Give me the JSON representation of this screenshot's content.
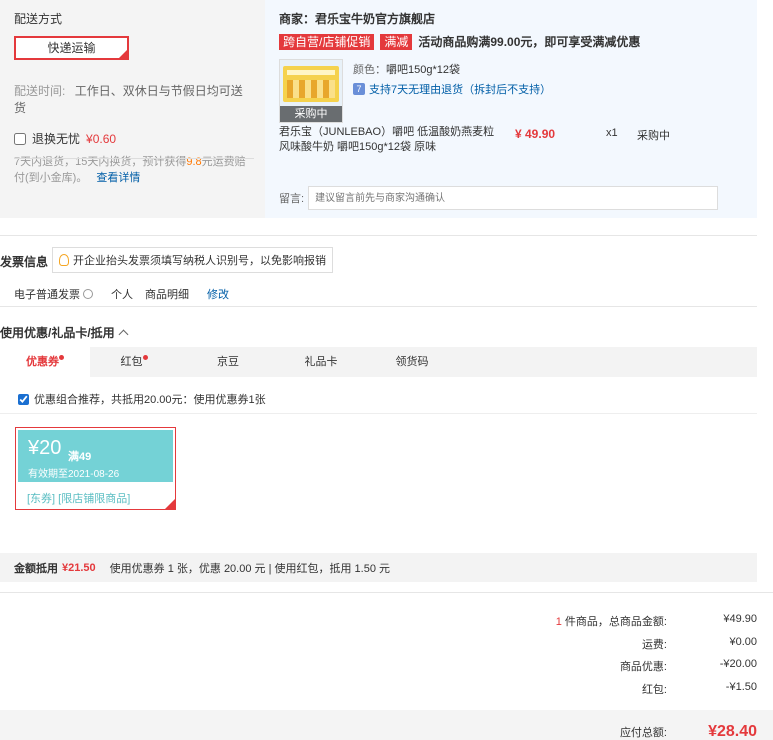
{
  "shipping": {
    "title": "配送方式",
    "express_label": "快递运输",
    "time_label": "配送时间:",
    "time_value": "工作日、双休日与节假日均可送货",
    "hassle_label": "退换无忧",
    "hassle_price": "¥0.60",
    "hassle_desc_1": "7天内退货，15天内换货，预计获得",
    "hassle_desc_highlight": "9.8",
    "hassle_desc_2": "元运费赔付(到小金库)。",
    "hassle_link": "查看详情"
  },
  "shop": {
    "name": "商家：君乐宝牛奶官方旗舰店",
    "tag1": "跨自营/店铺促销",
    "tag2": "满减",
    "promo_text": "活动商品购满99.00元，即可享受满减优惠",
    "product": {
      "thumb_label": "采购中",
      "spec_key": "颜色：",
      "spec_value": "嚼吧150g*12袋",
      "return_icon": "7",
      "return_text": "支持7天无理由退货（拆封后不支持）",
      "name": "君乐宝（JUNLEBAO）嚼吧 低温酸奶燕麦粒风味酸牛奶 嚼吧150g*12袋 原味",
      "price": "¥ 49.90",
      "qty": "x1",
      "status": "采购中"
    },
    "note_label": "留言:",
    "note_placeholder": "建议留言前先与商家沟通确认"
  },
  "invoice": {
    "title": "发票信息",
    "tip": "开企业抬头发票须填写纳税人识别号，以免影响报销",
    "type": "电子普通发票",
    "title_type": "个人",
    "content": "商品明细",
    "edit": "修改"
  },
  "coupons": {
    "title": "使用优惠/礼品卡/抵用",
    "tabs": [
      {
        "label": "优惠券"
      },
      {
        "label": "红包"
      },
      {
        "label": "京豆"
      },
      {
        "label": "礼品卡"
      },
      {
        "label": "领货码"
      }
    ],
    "combo_text": "优惠组合推荐，共抵用20.00元：使用优惠券1张",
    "card": {
      "amount": "¥20",
      "condition": "满49",
      "valid": "有效期至2021-08-26",
      "tags": "[东券]  [限店铺限商品]"
    },
    "summary_label": "金额抵用",
    "summary_amount": "¥21.50",
    "summary_detail": "使用优惠券 1 张，优惠 20.00 元  |  使用红包，抵用 1.50 元"
  },
  "totals": {
    "count": "1",
    "count_suffix": " 件商品，总商品金额:",
    "goods_amount": "¥49.90",
    "shipping_label": "运费:",
    "shipping_amount": "¥0.00",
    "discount_label": "商品优惠:",
    "discount_amount": "-¥20.00",
    "redpacket_label": "红包:",
    "redpacket_amount": "-¥1.50",
    "payable_label": "应付总额:",
    "payable_amount": "¥28.40"
  },
  "colors": {
    "accent": "#e4393c",
    "link": "#005ea7",
    "coupon": "#74d2d6"
  }
}
